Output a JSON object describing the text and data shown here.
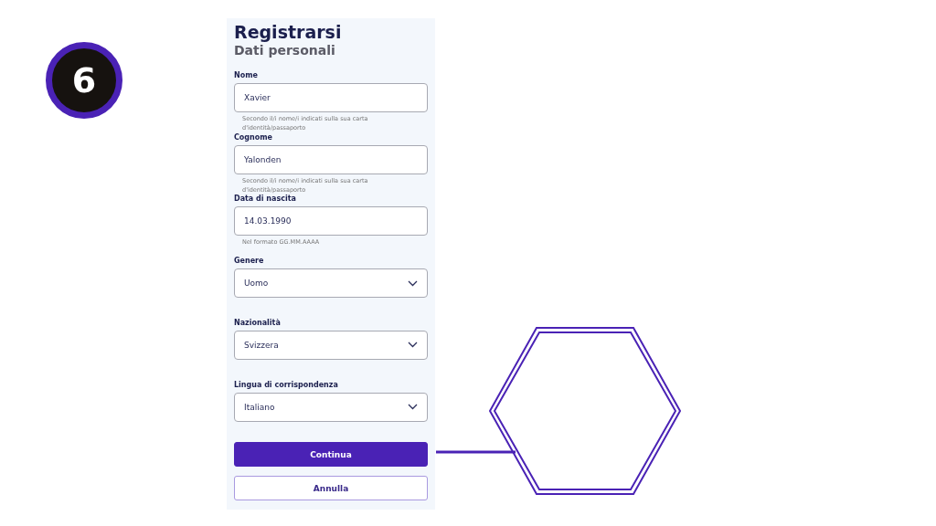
{
  "step_badge": "6",
  "form": {
    "title": "Registrarsi",
    "subtitle": "Dati personali",
    "fields": [
      {
        "kind": "text",
        "label": "Nome",
        "value": "Xavier",
        "helper": "Secondo il/i nome/i indicati sulla sua carta d'identità/passaporto"
      },
      {
        "kind": "text",
        "label": "Cognome",
        "value": "Yalonden",
        "helper": "Secondo il/i nome/i indicati sulla sua carta d'identità/passaporto"
      },
      {
        "kind": "text",
        "label": "Data di nascita",
        "value": "14.03.1990",
        "helper": "Nel formato GG.MM.AAAA"
      },
      {
        "kind": "select",
        "label": "Genere",
        "value": "Uomo"
      },
      {
        "kind": "select",
        "label": "Nazionalità",
        "value": "Svizzera"
      },
      {
        "kind": "select",
        "label": "Lingua di corrispondenza",
        "value": "Italiano"
      }
    ],
    "buttons": [
      {
        "kind": "primary",
        "label": "Continua"
      },
      {
        "kind": "secondary",
        "label": "Annulla"
      }
    ]
  }
}
